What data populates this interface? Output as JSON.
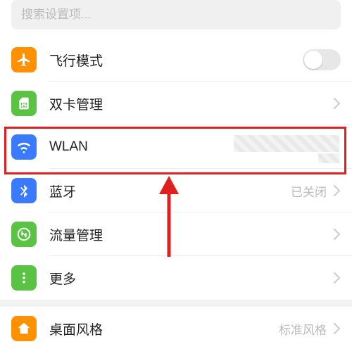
{
  "search": {
    "placeholder": "搜索设置项..."
  },
  "rows": [
    {
      "key": "airplane",
      "label": "飞行模式",
      "value": "",
      "type": "toggle",
      "icon_bg": "#ff9100"
    },
    {
      "key": "dualsim",
      "label": "双卡管理",
      "value": "",
      "type": "chevron",
      "icon_bg": "#5ac344"
    },
    {
      "key": "wlan",
      "label": "WLAN",
      "value": "",
      "type": "chevron",
      "icon_bg": "#3a7afe"
    },
    {
      "key": "bluetooth",
      "label": "蓝牙",
      "value": "已关闭",
      "type": "chevron",
      "icon_bg": "#3a7afe"
    },
    {
      "key": "data",
      "label": "流量管理",
      "value": "",
      "type": "chevron",
      "icon_bg": "#5ac344"
    },
    {
      "key": "more",
      "label": "更多",
      "value": "",
      "type": "chevron",
      "icon_bg": "#5ac344"
    },
    {
      "key": "desktop",
      "label": "桌面风格",
      "value": "标准风格",
      "type": "chevron",
      "icon_bg": "#ff9100"
    }
  ],
  "annotations": {
    "highlight_row": "wlan",
    "arrow_target_row": "wlan"
  }
}
